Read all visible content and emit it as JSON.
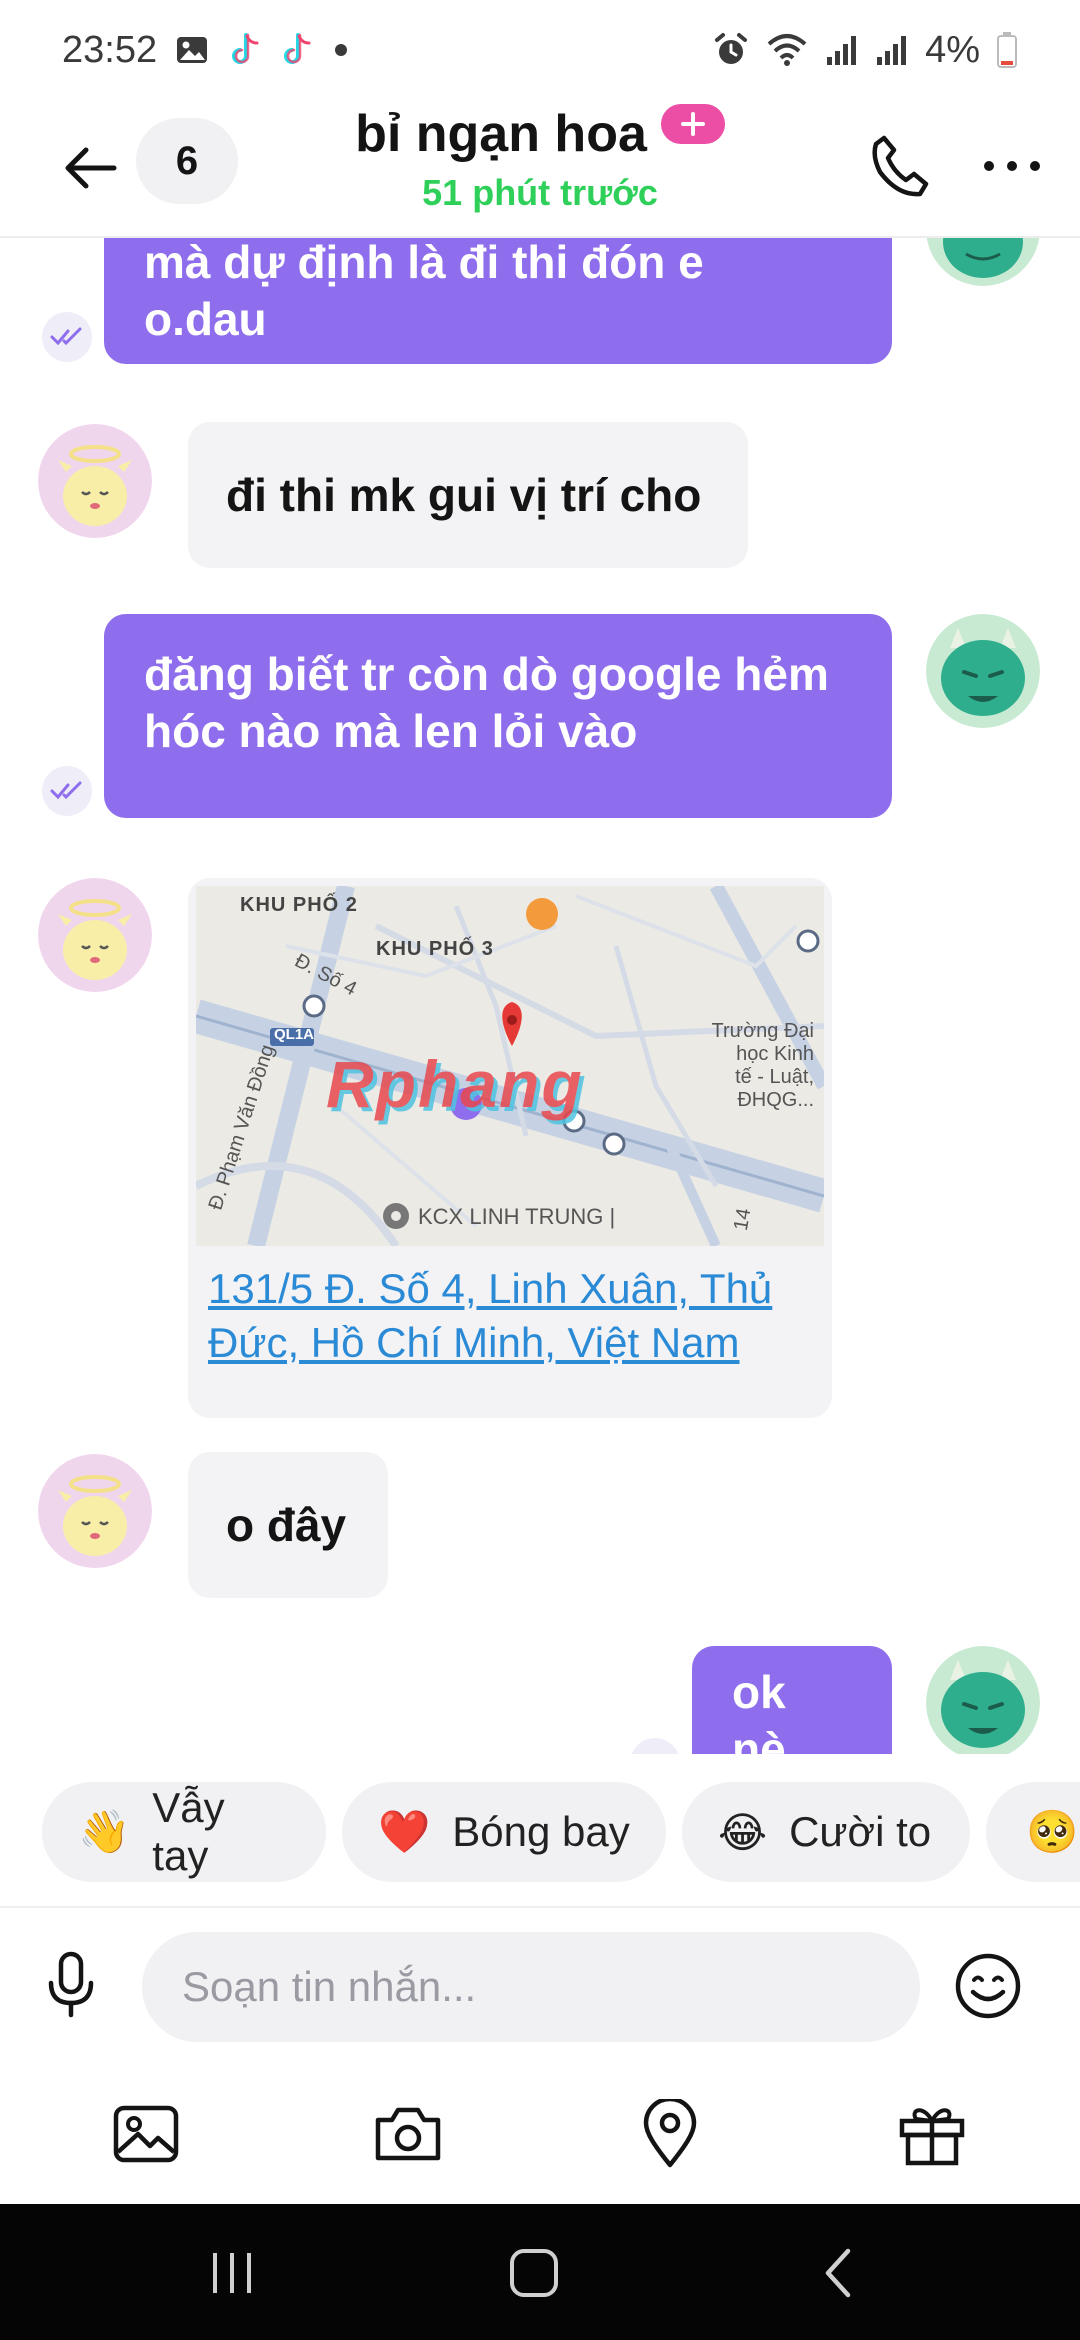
{
  "status_bar": {
    "time": "23:52",
    "battery": "4%",
    "icons": [
      "gallery-icon",
      "tiktok-icon",
      "tiktok-icon",
      "dot-icon",
      "alarm-icon",
      "wifi-icon",
      "signal-icon",
      "signal-icon",
      "battery-icon"
    ]
  },
  "header": {
    "unread_count": "6",
    "contact_name": "bỉ ngạn hoa",
    "last_seen": "51 phút trước"
  },
  "messages": [
    {
      "direction": "out",
      "lines": [
        "mà dự định là đi thi đón  e",
        "o.dau"
      ]
    },
    {
      "direction": "in",
      "text": "đi thi mk gui vị trí cho"
    },
    {
      "direction": "out",
      "lines": [
        "đăng biết tr còn dò google hẻm",
        "hóc nào mà len lỏi vào"
      ]
    },
    {
      "direction": "in",
      "type": "location",
      "map": {
        "khu_pho_2": "KHU PHỐ 2",
        "khu_pho_3": "KHU PHỐ 3",
        "street": "Đ. Số 4",
        "highway": "QL1A",
        "pham_van_dong": "Đ. Phạm Văn Đồng",
        "school_lines": [
          "Trường Đại",
          "học Kinh",
          "tế - Luật,",
          "ĐHQG..."
        ],
        "kcx": "KCX LINH TRUNG |",
        "watermark": "Rphang",
        "road_14": "14"
      },
      "address_lines": [
        "131/5 Đ. Số 4, Linh Xuân, Thủ",
        "Đức, Hồ Chí Minh, Việt Nam"
      ]
    },
    {
      "direction": "in",
      "text": "o đây"
    },
    {
      "direction": "out",
      "text": "ok nè"
    }
  ],
  "quick_reactions": [
    {
      "emoji": "👋",
      "label": "Vẫy tay"
    },
    {
      "emoji": "❤️",
      "label": "Bóng bay"
    },
    {
      "emoji": "😂",
      "label": "Cười to"
    },
    {
      "emoji": "🥺",
      "label": ""
    }
  ],
  "composer": {
    "placeholder": "Soạn tin nhắn..."
  },
  "colors": {
    "accent": "#8e6eec",
    "online": "#2fd05a",
    "link": "#2a8ad6",
    "badge": "#ec4ea6"
  }
}
